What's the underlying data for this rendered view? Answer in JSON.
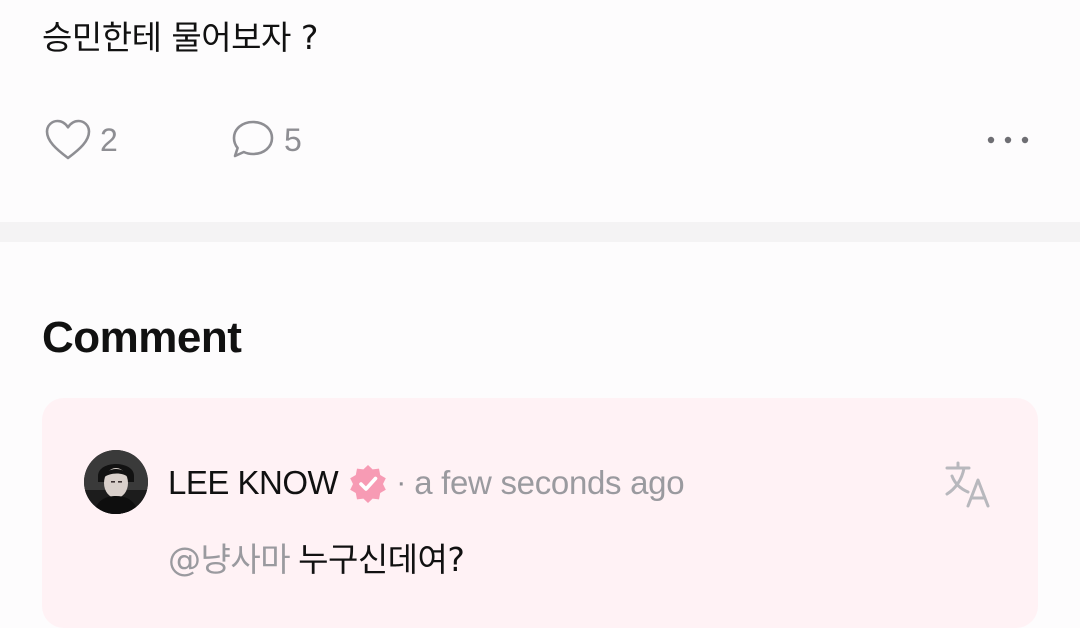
{
  "post": {
    "text": "승민한테 물어보자 ?"
  },
  "actions": {
    "like_count": "2",
    "comment_count": "5",
    "like_icon": "heart-outline-icon",
    "comment_icon": "speech-bubble-icon",
    "more_icon": "more-horizontal-icon"
  },
  "comments_section": {
    "title": "Comment",
    "items": [
      {
        "author": "LEE KNOW",
        "verified": true,
        "separator": "·",
        "time": "a few seconds ago",
        "mention": "@냥사마",
        "text": "누구신데여?",
        "translate_icon": "translate-icon"
      }
    ]
  },
  "colors": {
    "background": "#fdfcfd",
    "divider": "#f4f3f4",
    "card_background": "#fff2f5",
    "verified_badge": "#f79bb4",
    "muted_text": "#9a9a9f"
  }
}
